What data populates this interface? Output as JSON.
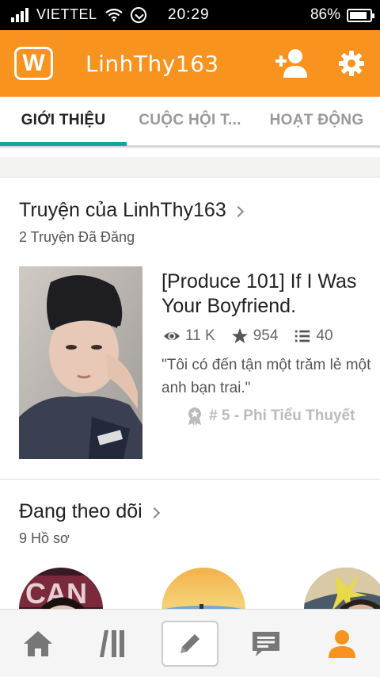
{
  "status_bar": {
    "carrier": "VIETTEL",
    "time": "20:29",
    "battery": "86%",
    "battery_level": 0.86
  },
  "app_bar": {
    "logo_letter": "W",
    "username": "LinhThy163",
    "icons": [
      "add-user-icon",
      "gear-icon"
    ],
    "accent_color": "#f7931e"
  },
  "tabs": [
    {
      "label": "GIỚI THIỆU",
      "active": true
    },
    {
      "label": "CUỘC HỘI T...",
      "active": false
    },
    {
      "label": "HOẠT ĐỘNG",
      "active": false
    }
  ],
  "stories": {
    "title": "Truyện của LinhThy163",
    "count": "2 Truyện Đã Đăng",
    "story": {
      "title": "[Produce 101] If I Was Your Boyfriend.",
      "views": "11 K",
      "votes": "954",
      "parts": "40",
      "description": "\"Tôi có đến tận một trăm lẻ một anh bạn trai.\"",
      "rank": "# 5 - Phi Tiểu Thuyết"
    }
  },
  "following": {
    "title": "Đang theo dõi",
    "count": "9 Hồ sơ"
  },
  "bottom_nav": [
    "home-icon",
    "library-icon",
    "write-icon",
    "messages-icon",
    "profile-icon"
  ],
  "colors": {
    "tab_underline": "#12a5a0",
    "nav_active": "#f7931e",
    "nav_inactive": "#777777"
  }
}
